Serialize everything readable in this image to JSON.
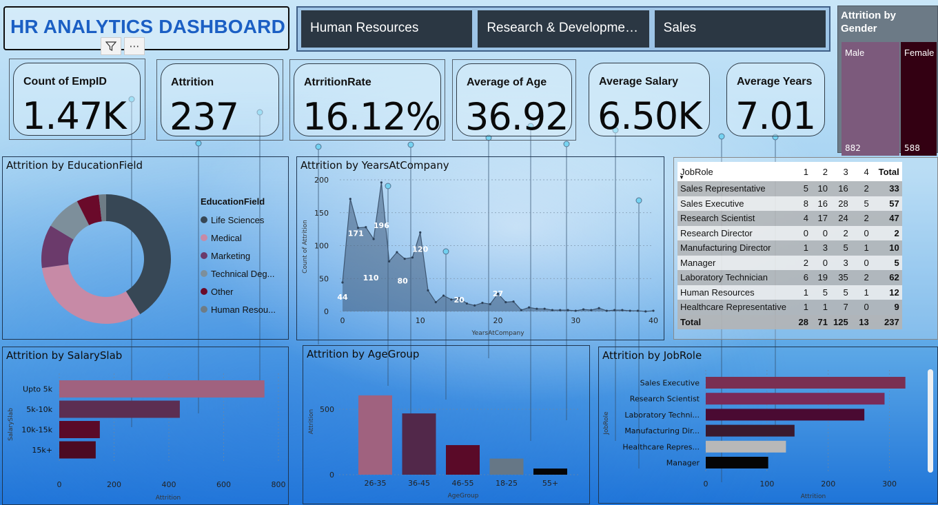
{
  "header": {
    "title": "HR ANALYTICS DASHBOARD"
  },
  "visual_icons": [
    "filter-icon",
    "more-options-icon"
  ],
  "slicer": {
    "options": [
      "Human Resources",
      "Research & Developme…",
      "Sales"
    ]
  },
  "kpis": [
    {
      "label": "Count of EmpID",
      "value": "1.47K"
    },
    {
      "label": "Attrition",
      "value": "237"
    },
    {
      "label": "AtrritionRate",
      "value": "16.12%"
    },
    {
      "label": "Average of Age",
      "value": "36.92"
    },
    {
      "label": "Average Salary",
      "value": "6.50K"
    },
    {
      "label": "Average Years",
      "value": "7.01"
    }
  ],
  "gender": {
    "title_line1": "Attrition by",
    "title_line2": "Gender",
    "male_label": "Male",
    "male_count": "882",
    "female_label": "Female",
    "female_count": "588"
  },
  "education": {
    "title": "Attrition by EducationField",
    "legend_title": "EducationField",
    "items": [
      {
        "label": "Life Sciences",
        "color": "#374755"
      },
      {
        "label": "Medical",
        "color": "#c78aa6"
      },
      {
        "label": "Marketing",
        "color": "#6b3a6b"
      },
      {
        "label": "Technical Deg...",
        "color": "#7d8f9b"
      },
      {
        "label": "Other",
        "color": "#6a0a2a"
      },
      {
        "label": "Human Resou...",
        "color": "#6e7c86"
      }
    ]
  },
  "years": {
    "title": "Attrition by YearsAtCompany",
    "xlabel": "YearsAtCompany",
    "ylabel": "Count of Attrition",
    "yticks": [
      "0",
      "50",
      "100",
      "150",
      "200"
    ],
    "xticks": [
      "0",
      "10",
      "20",
      "30",
      "40"
    ]
  },
  "matrix": {
    "headers": [
      "JobRole",
      "1",
      "2",
      "3",
      "4",
      "Total"
    ],
    "rows": [
      [
        "Sales Representative",
        "5",
        "10",
        "16",
        "2",
        "33"
      ],
      [
        "Sales Executive",
        "8",
        "16",
        "28",
        "5",
        "57"
      ],
      [
        "Research Scientist",
        "4",
        "17",
        "24",
        "2",
        "47"
      ],
      [
        "Research Director",
        "0",
        "0",
        "2",
        "0",
        "2"
      ],
      [
        "Manufacturing Director",
        "1",
        "3",
        "5",
        "1",
        "10"
      ],
      [
        "Manager",
        "2",
        "0",
        "3",
        "0",
        "5"
      ],
      [
        "Laboratory Technician",
        "6",
        "19",
        "35",
        "2",
        "62"
      ],
      [
        "Human Resources",
        "1",
        "5",
        "5",
        "1",
        "12"
      ],
      [
        "Healthcare Representative",
        "1",
        "1",
        "7",
        "0",
        "9"
      ]
    ],
    "total": [
      "Total",
      "28",
      "71",
      "125",
      "13",
      "237"
    ]
  },
  "salary": {
    "title": "Attrition by SalarySlab",
    "xlabel": "Attrition",
    "ylabel": "SalarySlab",
    "xticks": [
      "0",
      "200",
      "400",
      "600",
      "800"
    ]
  },
  "age": {
    "title": "Attrition by AgeGroup",
    "xlabel": "AgeGroup",
    "ylabel": "Attrition",
    "yticks": [
      "0",
      "500"
    ]
  },
  "jobrole": {
    "title": "Attrition by JobRole",
    "xlabel": "Attrition",
    "ylabel": "JobRole",
    "xticks": [
      "0",
      "100",
      "200",
      "300"
    ]
  },
  "chart_data": [
    {
      "type": "pie",
      "title": "Attrition by EducationField",
      "categories": [
        "Life Sciences",
        "Medical",
        "Marketing",
        "Technical Degree",
        "Other",
        "Human Resources"
      ],
      "values": [
        606,
        464,
        159,
        132,
        82,
        27
      ],
      "donut": true,
      "legend": "right"
    },
    {
      "type": "area",
      "title": "Attrition by YearsAtCompany",
      "xlabel": "YearsAtCompany",
      "ylabel": "Count of Attrition",
      "x": [
        0,
        1,
        2,
        3,
        4,
        5,
        6,
        7,
        8,
        9,
        10,
        11,
        12,
        13,
        14,
        15,
        16,
        17,
        18,
        19,
        20,
        21,
        22,
        23,
        24,
        25,
        26,
        27,
        28,
        29,
        30,
        31,
        32,
        33,
        34,
        35,
        36,
        37,
        38,
        39,
        40
      ],
      "values": [
        44,
        171,
        127,
        128,
        110,
        196,
        76,
        90,
        80,
        82,
        120,
        32,
        14,
        24,
        18,
        20,
        12,
        9,
        13,
        11,
        27,
        14,
        15,
        2,
        6,
        4,
        4,
        2,
        2,
        2,
        1,
        3,
        2,
        5,
        1,
        2,
        2,
        1,
        1,
        0,
        1
      ],
      "data_labels": {
        "0": "44",
        "1": "171",
        "4": "110",
        "5": "196",
        "8": "80",
        "10": "120",
        "15": "20",
        "20": "27"
      },
      "xlim": [
        0,
        40
      ],
      "ylim": [
        0,
        200
      ]
    },
    {
      "type": "bar",
      "orientation": "horizontal",
      "title": "Attrition by SalarySlab",
      "categories": [
        "Upto 5k",
        "5k-10k",
        "10k-15k",
        "15k+"
      ],
      "values": [
        749,
        440,
        148,
        133
      ],
      "colors": [
        "#a0627f",
        "#5c2e52",
        "#5a0a28",
        "#4c0a22"
      ],
      "xlim": [
        0,
        800
      ]
    },
    {
      "type": "bar",
      "title": "Attrition by AgeGroup",
      "categories": [
        "26-35",
        "36-45",
        "46-55",
        "18-25",
        "55+"
      ],
      "values": [
        606,
        468,
        226,
        123,
        47
      ],
      "colors": [
        "#a0627f",
        "#52284a",
        "#5a0a28",
        "#667786",
        "#050505"
      ],
      "ylim": [
        0,
        700
      ]
    },
    {
      "type": "bar",
      "orientation": "horizontal",
      "title": "Attrition by JobRole",
      "categories": [
        "Sales Executive",
        "Research Scientist",
        "Laboratory Techni...",
        "Manufacturing Dir...",
        "Healthcare Repres...",
        "Manager"
      ],
      "values": [
        326,
        292,
        259,
        145,
        131,
        102
      ],
      "colors": [
        "#7a2f52",
        "#7a2a58",
        "#4a0a32",
        "#3a1a2e",
        "#b8b8b8",
        "#050505"
      ],
      "xlim": [
        0,
        350
      ]
    }
  ]
}
